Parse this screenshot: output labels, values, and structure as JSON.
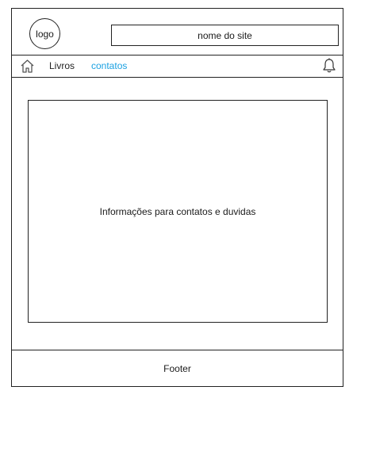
{
  "header": {
    "logo_text": "logo",
    "site_name": "nome do site"
  },
  "navbar": {
    "home_icon": "home-icon",
    "links": [
      {
        "label": "Livros",
        "active": false
      },
      {
        "label": "contatos",
        "active": true
      }
    ],
    "notification_icon": "bell-icon",
    "active_color": "#1ba1e2"
  },
  "main": {
    "content_text": "Informações para contatos e duvidas"
  },
  "footer": {
    "label": "Footer"
  }
}
